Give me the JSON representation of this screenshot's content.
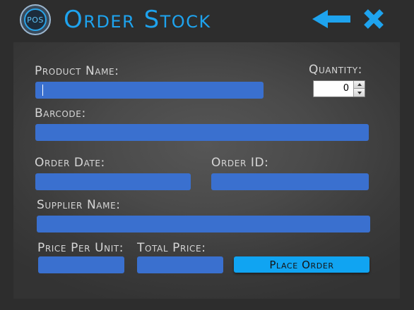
{
  "window": {
    "logo_text": "POS",
    "title": "Order Stock",
    "accent_color": "#1ea3ee",
    "field_color": "#3a70cf",
    "back_icon": "arrow-left-icon",
    "close_icon": "x-close-icon"
  },
  "form": {
    "product_name": {
      "label": "Product Name:",
      "value": ""
    },
    "quantity": {
      "label": "Quantity:",
      "value": "0"
    },
    "barcode": {
      "label": "Barcode:",
      "value": ""
    },
    "order_date": {
      "label": "Order Date:",
      "value": ""
    },
    "order_id": {
      "label": "Order ID:",
      "value": ""
    },
    "supplier_name": {
      "label": "Supplier Name:",
      "value": ""
    },
    "price_per_unit": {
      "label": "Price Per Unit:",
      "value": ""
    },
    "total_price": {
      "label": "Total Price:",
      "value": ""
    }
  },
  "actions": {
    "place_order_label": "Place Order"
  }
}
